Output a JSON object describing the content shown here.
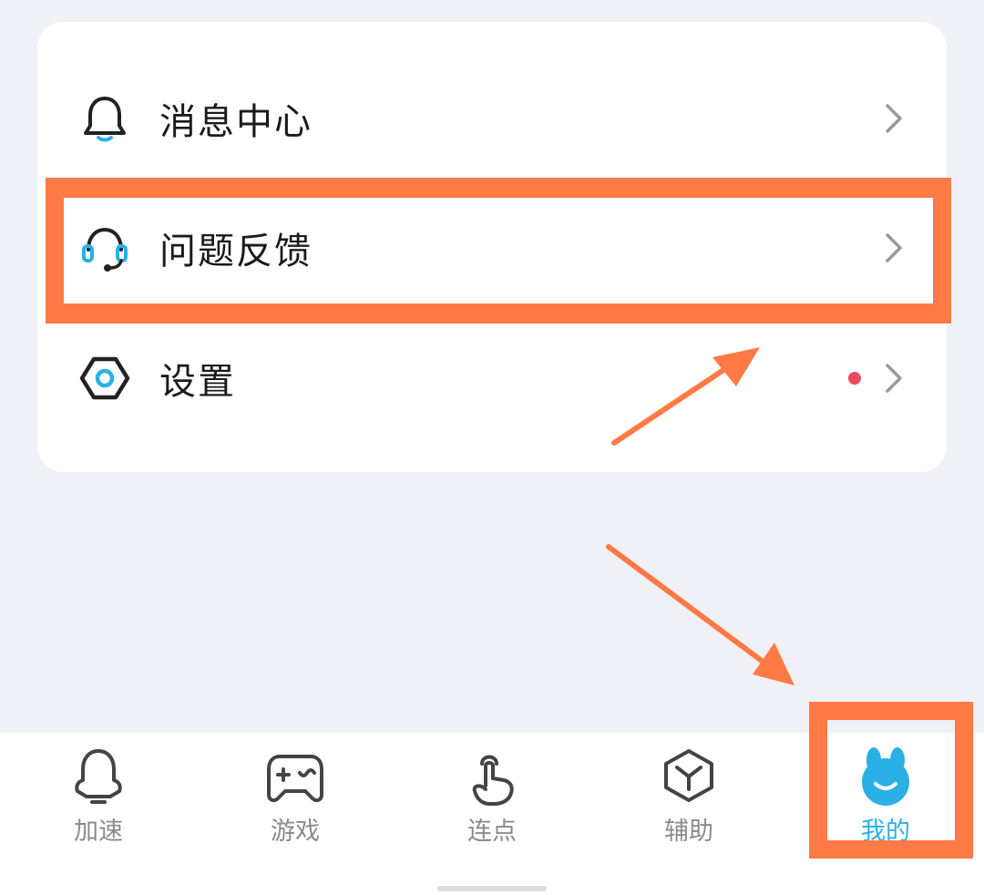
{
  "menu": {
    "items": [
      {
        "label": "消息中心",
        "icon": "bell-icon"
      },
      {
        "label": "问题反馈",
        "icon": "headset-icon"
      },
      {
        "label": "设置",
        "icon": "settings-hexagon-icon",
        "has_notification_dot": true
      }
    ]
  },
  "tabbar": {
    "items": [
      {
        "label": "加速",
        "icon": "rocket-ghost-icon"
      },
      {
        "label": "游戏",
        "icon": "gamepad-icon"
      },
      {
        "label": "连点",
        "icon": "tap-finger-icon"
      },
      {
        "label": "辅助",
        "icon": "cube-icon"
      },
      {
        "label": "我的",
        "icon": "bunny-avatar-icon",
        "active": true
      }
    ]
  },
  "colors": {
    "accent": "#2ab0e7",
    "annotation": "#ff7a45",
    "notification_dot": "#e84a5f",
    "background": "#f0f1f6"
  }
}
